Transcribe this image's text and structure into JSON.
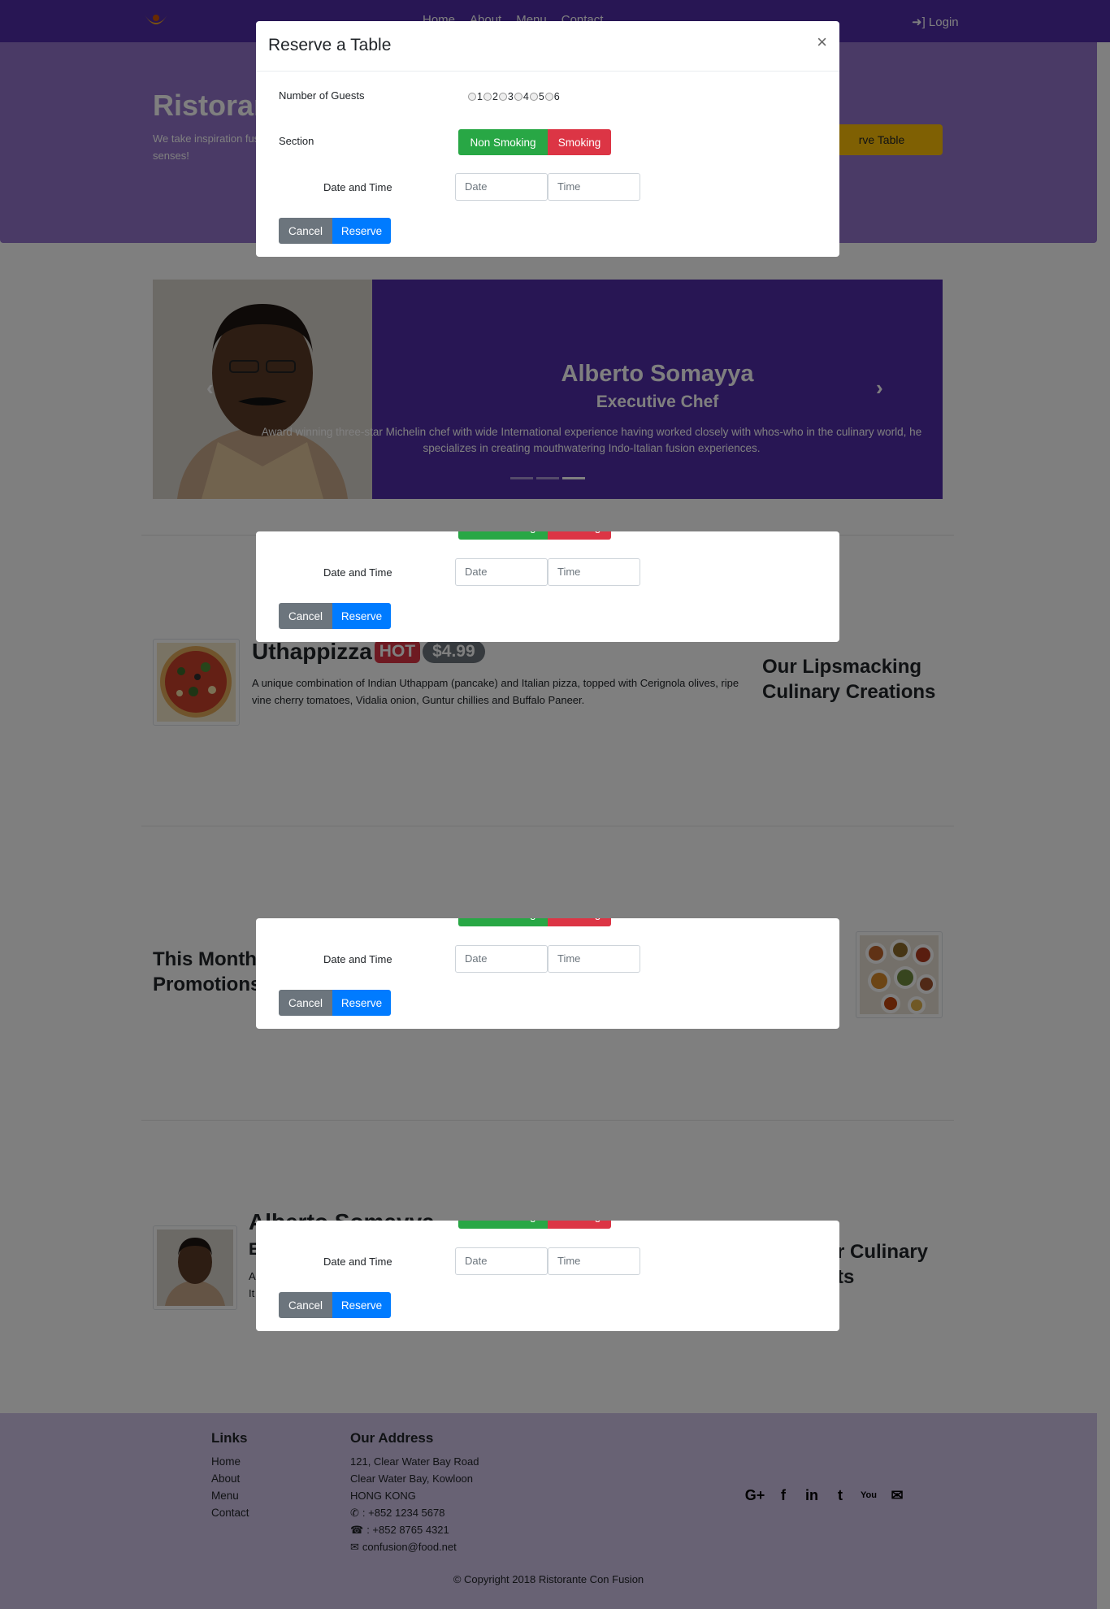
{
  "navbar": {
    "links": [
      "Home",
      "About",
      "Menu",
      "Contact"
    ],
    "login": "Login"
  },
  "jumbotron": {
    "title": "Ristoran",
    "text": "We take inspiration fusion experience. C senses!",
    "button": "rve Table"
  },
  "carousel": {
    "name": "Alberto Somayya",
    "role": "Executive Chef",
    "text": "Award winning three-star Michelin chef with wide International experience having worked closely with whos-who in the culinary world, he specializes in creating mouthwatering Indo-Italian fusion experiences.",
    "prev_icon": "chevron-left-icon",
    "next_icon": "chevron-right-icon"
  },
  "dish": {
    "name": "Uthappizza",
    "badge": "HOT",
    "price": "$4.99",
    "description": "A unique combination of Indian Uthappam (pancake) and Italian pizza, topped with Cerignola olives, ripe vine cherry tomatoes, Vidalia onion, Guntur chillies and Buffalo Paneer.",
    "side_heading": "Our Lipsmacking Culinary Creations"
  },
  "promotion": {
    "heading": "This Month Promotions"
  },
  "leader": {
    "heading": "Alberto Somayya",
    "sub": "E",
    "text": "A c It",
    "side_heading": "r Culinary ts"
  },
  "modal": {
    "title": "Reserve a Table",
    "close": "×",
    "guests_label": "Number of Guests",
    "guest_options": [
      "1",
      "2",
      "3",
      "4",
      "5",
      "6"
    ],
    "section_label": "Section",
    "non_smoking": "Non Smoking",
    "smoking": "Smoking",
    "datetime_label": "Date and Time",
    "date_placeholder": "Date",
    "time_placeholder": "Time",
    "cancel": "Cancel",
    "reserve": "Reserve"
  },
  "footer": {
    "links_heading": "Links",
    "links": [
      "Home",
      "About",
      "Menu",
      "Contact"
    ],
    "address_heading": "Our Address",
    "address_lines": [
      "121, Clear Water Bay Road",
      "Clear Water Bay, Kowloon",
      "HONG KONG"
    ],
    "phone": ": +852 1234 5678",
    "fax": ": +852 8765 4321",
    "email": "confusion@food.net",
    "social_icons": [
      "google-plus-icon",
      "facebook-icon",
      "linkedin-icon",
      "twitter-icon",
      "youtube-icon",
      "mail-icon"
    ],
    "social_glyphs": [
      "G+",
      "f",
      "in",
      "t",
      "You",
      "✉"
    ],
    "copyright": "© Copyright 2018 Ristorante Con Fusion"
  },
  "colors": {
    "navbar": "#512da8",
    "jumbotron": "#9575cd",
    "footer": "#d1c4e9",
    "accent_yellow": "#ffc107"
  }
}
